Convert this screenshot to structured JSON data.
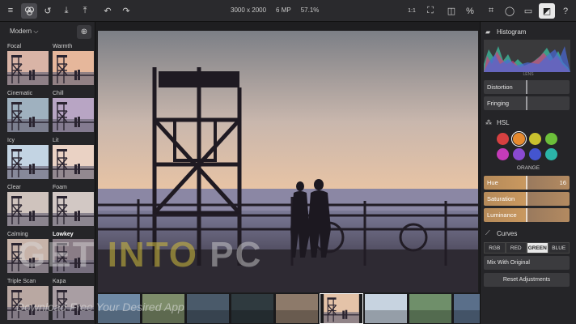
{
  "toolbar": {
    "dimensions": "3000 x 2000",
    "megapixels": "6 MP",
    "zoom": "57.1%",
    "zoom_one_to_one": "1:1",
    "help": "?"
  },
  "presets": {
    "category": "Modern",
    "items": [
      {
        "label": "Focal",
        "tint": "#d9b4a6"
      },
      {
        "label": "Warmth",
        "tint": "#e6b79b"
      },
      {
        "label": "Cinematic",
        "tint": "#9fb1bf"
      },
      {
        "label": "Chill",
        "tint": "#b8a5c4"
      },
      {
        "label": "Icy",
        "tint": "#c3d4e3"
      },
      {
        "label": "Lit",
        "tint": "#ead2c4"
      },
      {
        "label": "Clear",
        "tint": "#cfc3bd"
      },
      {
        "label": "Foam",
        "tint": "#d2c8c4"
      },
      {
        "label": "Calming",
        "tint": "#c7b3a9"
      },
      {
        "label": "Lowkey",
        "tint": "#8a7d86"
      },
      {
        "label": "Triple Scan",
        "tint": "#b9a8a2"
      },
      {
        "label": "Kapa",
        "tint": "#a99ea3"
      }
    ]
  },
  "right_panel": {
    "histogram_title": "Histogram",
    "lens_label": "LENS",
    "distortion": "Distortion",
    "fringing": "Fringing",
    "hsl_title": "HSL",
    "swatches": [
      "#d64040",
      "#e68a2e",
      "#c9c22e",
      "#6cbf3a",
      "#c43bb8",
      "#8a4ad0",
      "#4455d0",
      "#2bb4a8"
    ],
    "active_swatch": 1,
    "selected_color": "ORANGE",
    "hue_label": "Hue",
    "hue_value": "16",
    "saturation_label": "Saturation",
    "luminance_label": "Luminance",
    "curves_title": "Curves",
    "curve_tabs": [
      "RGB",
      "RED",
      "GREEN",
      "BLUE"
    ],
    "active_curve_tab": 2,
    "mix_label": "Mix With Original",
    "reset_label": "Reset Adjustments"
  },
  "watermark": {
    "get": "GET ",
    "into": "INTO",
    "pc": " PC",
    "sub": "Download Free Your Desired App"
  }
}
